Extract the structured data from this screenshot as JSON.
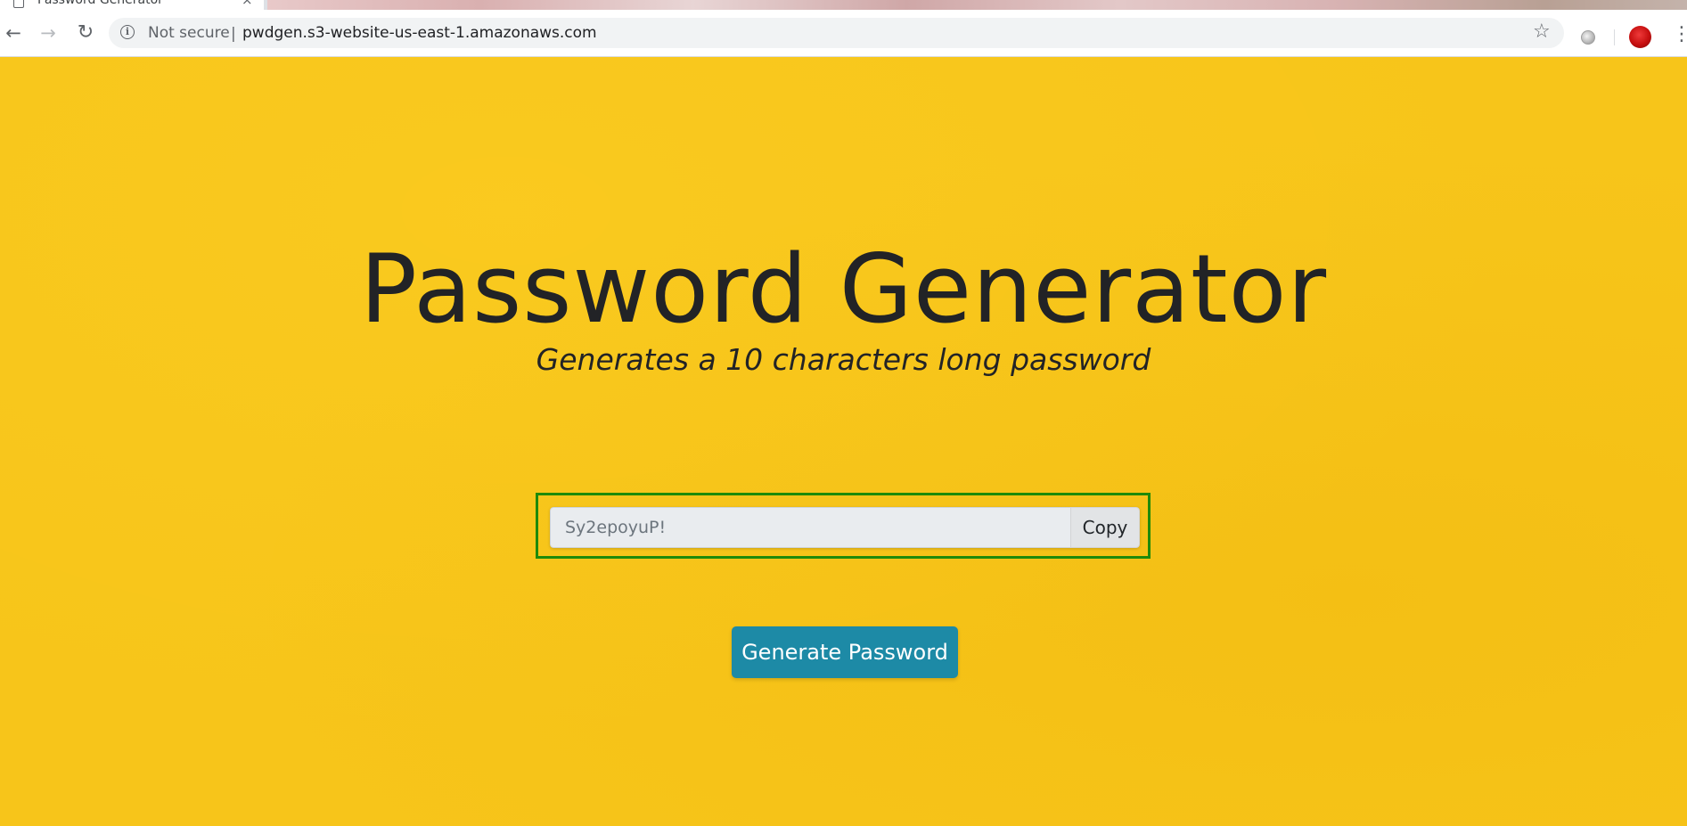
{
  "browser": {
    "tab": {
      "title": "Password Generator",
      "close_glyph": "×"
    },
    "new_tab_glyph": "+",
    "nav": {
      "back_glyph": "←",
      "forward_glyph": "→",
      "reload_glyph": "↻"
    },
    "omnibox": {
      "info_glyph": "i",
      "security_label": "Not secure",
      "divider": "|",
      "url": "pwdgen.s3-website-us-east-1.amazonaws.com",
      "star_glyph": "☆"
    },
    "menu_glyph": "⋮"
  },
  "page": {
    "title": "Password Generator",
    "subtitle": "Generates a 10 characters long password",
    "password_value": "Sy2epoyuP!",
    "copy_label": "Copy",
    "generate_label": "Generate Password"
  },
  "colors": {
    "background": "#f7c51a",
    "generate_button": "#1d8aa6",
    "highlight_border": "#1e8a0a",
    "title_text": "#222326"
  },
  "icons": {
    "tab_favicon": "page-icon",
    "back": "arrow-left-icon",
    "forward": "arrow-right-icon",
    "reload": "reload-icon",
    "info": "info-icon",
    "star": "star-icon",
    "extension": "extension-icon",
    "avatar": "profile-avatar",
    "menu": "kebab-menu-icon"
  }
}
